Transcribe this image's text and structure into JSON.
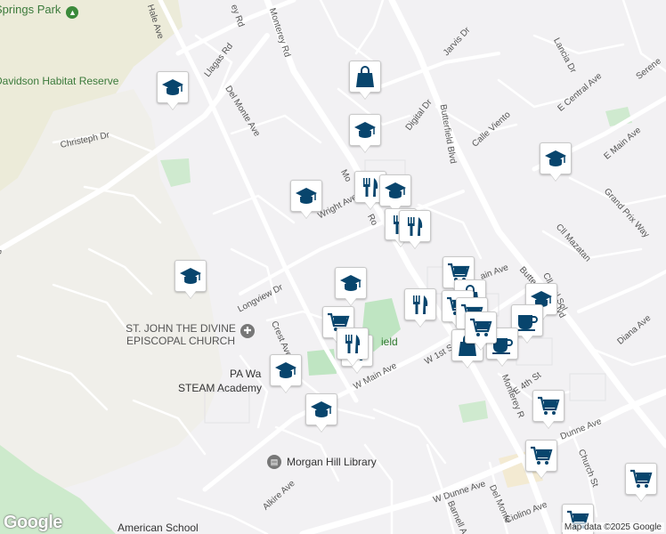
{
  "map": {
    "attribution": "Map data ©2025 Google",
    "logo": "Google",
    "colors": {
      "background": "#f2f1f3",
      "road": "#ffffff",
      "park": "#c9e9c9",
      "marker": "#08456d",
      "label": "#555555"
    }
  },
  "places": [
    {
      "name": "Springs Park",
      "type": "park"
    },
    {
      "name": "Davidson Habitat Reserve",
      "type": "park"
    },
    {
      "name": "ST. JOHN THE DIVINE EPISCOPAL CHURCH",
      "type": "church"
    },
    {
      "name": "PA Wa",
      "type": "school"
    },
    {
      "name": "STEAM Academy",
      "type": "school"
    },
    {
      "name": "Morgan Hill Library",
      "type": "library"
    },
    {
      "name": "American School",
      "type": "school"
    },
    {
      "name": "ield",
      "type": "park"
    }
  ],
  "streets": [
    "Hale Ave",
    "ey Rd",
    "Monterey Rd",
    "Llagas Rd",
    "Del Monte Ave",
    "Christeph Dr",
    "Wright Ave",
    "Longview Dr",
    "Crest Ave",
    "W Main Ave",
    "Alkire Ave",
    "W Dunne Ave",
    "Jarvis Dr",
    "Digital Dr",
    "Butterfield Blvd",
    "Calle Viento",
    "Lancia Dr",
    "E Central Ave",
    "Serene",
    "E Main Ave",
    "Grand Prix Way",
    "Cll Mazatan",
    "Cll Del Sol",
    "Diana Ave",
    "E 4th St",
    "Dunne Ave",
    "Church St",
    "Ciolino Ave",
    "Barnell A",
    "Del Monte",
    "W 1st S",
    "Monterey R",
    "Mo",
    "Ro",
    "ain Ave",
    "Butte",
    "lvd",
    "d"
  ],
  "markers": [
    "school",
    "shopping",
    "school",
    "school",
    "school",
    "restaurant",
    "school",
    "restaurant",
    "restaurant",
    "school",
    "school",
    "shopping",
    "shopping",
    "restaurant",
    "shopping",
    "shopping",
    "school",
    "school",
    "shopping",
    "cafe",
    "cafe",
    "shopping",
    "restaurant",
    "school",
    "shopping",
    "shopping",
    "shopping",
    "shopping",
    "shopping",
    "restaurant"
  ]
}
